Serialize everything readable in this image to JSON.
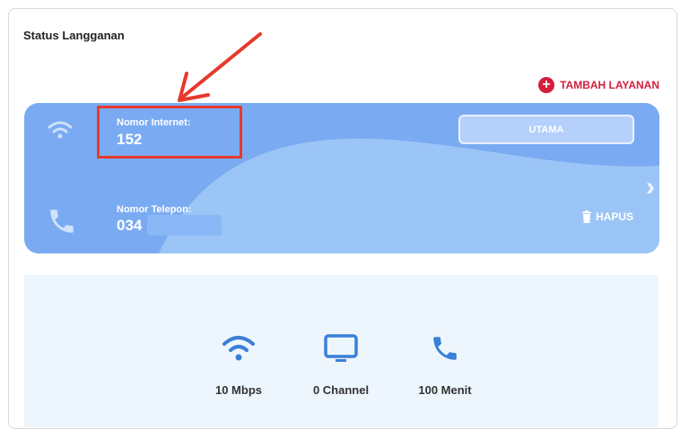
{
  "section": {
    "title": "Status Langganan",
    "add_service_label": "TAMBAH LAYANAN"
  },
  "card": {
    "internet_label": "Nomor Internet:",
    "internet_value": "152",
    "phone_label": "Nomor Telepon:",
    "phone_value": "034",
    "primary_label": "UTAMA",
    "delete_label": "HAPUS"
  },
  "features": [
    {
      "icon": "wifi-icon",
      "label": "10 Mbps"
    },
    {
      "icon": "tv-icon",
      "label": "0 Channel"
    },
    {
      "icon": "phone-icon",
      "label": "100 Menit"
    }
  ],
  "colors": {
    "card_bg": "#7aabf2",
    "accent_red": "#d21f3c",
    "icon_blue": "#3a7fd8",
    "feature_bg": "#eef6fd"
  }
}
